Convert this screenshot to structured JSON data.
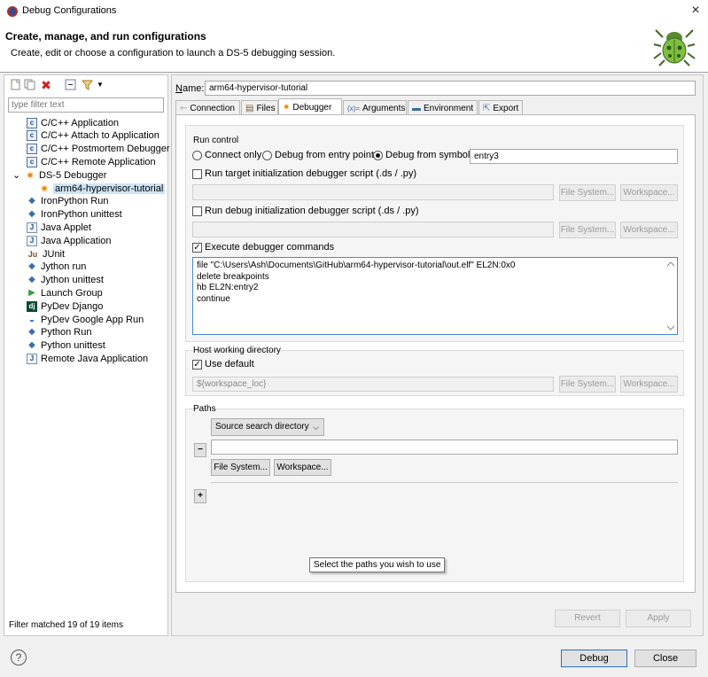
{
  "window": {
    "title": "Debug Configurations",
    "close_glyph": "×"
  },
  "banner": {
    "title": "Create, manage, and run configurations",
    "subtitle": "Create, edit or choose a configuration to launch a DS-5 debugging session.",
    "icon": "bug-icon"
  },
  "left": {
    "filter_placeholder": "type filter text",
    "items": [
      {
        "label": "C/C++ Application",
        "icon": "c-icon"
      },
      {
        "label": "C/C++ Attach to Application",
        "icon": "c-icon"
      },
      {
        "label": "C/C++ Postmortem Debugger",
        "icon": "c-icon"
      },
      {
        "label": "C/C++ Remote Application",
        "icon": "c-icon"
      },
      {
        "label": "DS-5 Debugger",
        "icon": "ds5-icon"
      },
      {
        "label": "arm64-hypervisor-tutorial",
        "icon": "ds5-icon",
        "selected": true
      },
      {
        "label": "IronPython Run",
        "icon": "python-icon"
      },
      {
        "label": "IronPython unittest",
        "icon": "python-icon"
      },
      {
        "label": "Java Applet",
        "icon": "java-icon"
      },
      {
        "label": "Java Application",
        "icon": "java-icon"
      },
      {
        "label": "JUnit",
        "icon": "junit-icon"
      },
      {
        "label": "Jython run",
        "icon": "python-icon"
      },
      {
        "label": "Jython unittest",
        "icon": "python-icon"
      },
      {
        "label": "Launch Group",
        "icon": "launch-icon"
      },
      {
        "label": "PyDev Django",
        "icon": "django-icon"
      },
      {
        "label": "PyDev Google App Run",
        "icon": "google-icon"
      },
      {
        "label": "Python Run",
        "icon": "python-icon"
      },
      {
        "label": "Python unittest",
        "icon": "python-icon"
      },
      {
        "label": "Remote Java Application",
        "icon": "java-icon"
      }
    ],
    "status": "Filter matched 19 of 19 items"
  },
  "right": {
    "name_label": "Name:",
    "name_value": "arm64-hypervisor-tutorial",
    "tabs": [
      {
        "label": "Connection",
        "icon": "connection-icon"
      },
      {
        "label": "Files",
        "icon": "files-icon"
      },
      {
        "label": "Debugger",
        "icon": "ds5-icon",
        "active": true
      },
      {
        "label": "Arguments",
        "icon": "arguments-icon"
      },
      {
        "label": "Environment",
        "icon": "environment-icon"
      },
      {
        "label": "Export",
        "icon": "export-icon"
      }
    ],
    "run_control": {
      "label": "Run control",
      "connect_only": "Connect only",
      "debug_entry": "Debug from entry point",
      "debug_symbol": "Debug from symbol",
      "symbol_value": "entry3",
      "run_target_script": "Run target initialization debugger script (.ds / .py)",
      "run_debug_script": "Run debug initialization debugger script (.ds / .py)",
      "execute_cmds": "Execute debugger commands",
      "commands": "file \"C:\\Users\\Ash\\Documents\\GitHub\\arm64-hypervisor-tutorial\\out.elf\" EL2N:0x0\ndelete breakpoints\nhb EL2N:entry2\ncontinue",
      "file_system": "File System...",
      "workspace": "Workspace..."
    },
    "host_dir": {
      "label": "Host working directory",
      "use_default": "Use default",
      "value": "${workspace_loc}",
      "file_system": "File System...",
      "workspace": "Workspace..."
    },
    "paths": {
      "label": "Paths",
      "select_value": "Source search directory",
      "minus": "−",
      "plus": "+",
      "file_system": "File System...",
      "workspace": "Workspace..."
    },
    "tooltip": "Select the paths you wish to use",
    "revert": "Revert",
    "apply": "Apply"
  },
  "footer": {
    "help": "?",
    "debug": "Debug",
    "close": "Close"
  }
}
